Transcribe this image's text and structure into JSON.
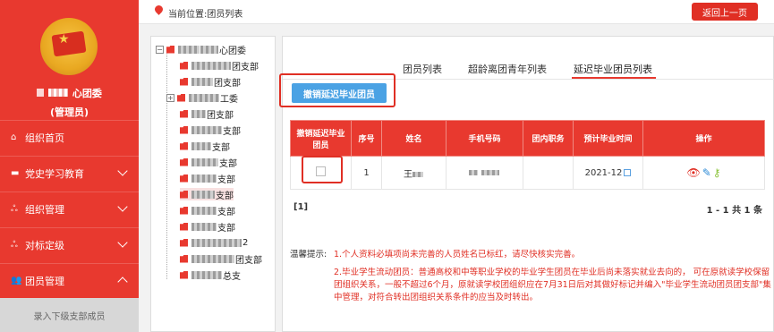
{
  "sidebar": {
    "org_name": "心团委",
    "org_role": "(管理员)",
    "nav": [
      {
        "label": "组织首页",
        "icon": "home-icon"
      },
      {
        "label": "党史学习教育",
        "icon": "folder-icon"
      },
      {
        "label": "组织管理",
        "icon": "org-tree-icon"
      },
      {
        "label": "对标定级",
        "icon": "org-tree-icon"
      },
      {
        "label": "团员管理",
        "icon": "users-icon"
      }
    ],
    "sub_item": "录入下级支部成员"
  },
  "topbar": {
    "location": "当前位置:团员列表",
    "back_button": "返回上一页"
  },
  "tree": {
    "nodes": [
      {
        "label": "心团委"
      },
      {
        "label": "团支部"
      },
      {
        "label": "团支部"
      },
      {
        "label": "工委"
      },
      {
        "label": "团支部"
      },
      {
        "label": "支部"
      },
      {
        "label": "支部"
      },
      {
        "label": "支部"
      },
      {
        "label": "支部"
      },
      {
        "label": "支部"
      },
      {
        "label": "支部"
      },
      {
        "label": "支部"
      },
      {
        "label": "2"
      },
      {
        "label": "团支部"
      },
      {
        "label": "总支"
      }
    ]
  },
  "tabs": {
    "tab1": "团员列表",
    "tab2": "超龄离团青年列表",
    "tab3": "延迟毕业团员列表"
  },
  "cancel_button": "撤销延迟毕业团员",
  "table": {
    "headers": {
      "h0a": "撤销延迟毕业",
      "h0b": "团员",
      "h1": "序号",
      "h2": "姓名",
      "h3": "手机号码",
      "h4": "团内职务",
      "h5": "预计毕业时间",
      "h6": "操作"
    },
    "row": {
      "index": "1",
      "name": "王",
      "phone": "",
      "position": "",
      "grad_time": "2021-12"
    }
  },
  "pager": {
    "left": "[1]",
    "right": "1 - 1  共 1 条"
  },
  "tips": {
    "label": "温馨提示:",
    "t1": "1.个人资料必填项尚未完善的人员姓名已标红，请尽快核实完善。",
    "t2": "2.毕业学生流动团员：普通高校和中等职业学校的毕业学生团员在毕业后尚未落实就业去向的， 可在原就读学校保留团组织关系，一般不超过6个月，原就读学校团组织应在7月31日后对其做好标记并编入\"毕业学生流动团员团支部\"集中管理，对符合转出团组织关系条件的应当及时转出。"
  },
  "colors": {
    "brand_red": "#e8392f",
    "button_blue": "#4aa2e4"
  }
}
